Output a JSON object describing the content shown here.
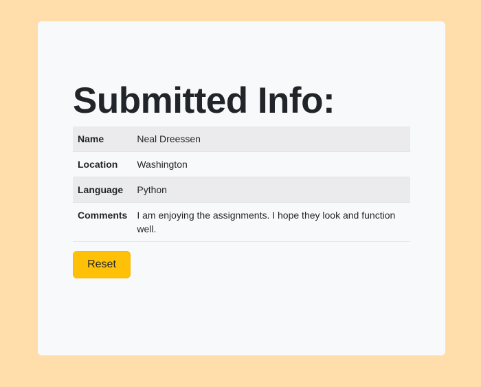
{
  "page": {
    "title": "Submitted Info:"
  },
  "info_table": {
    "rows": [
      {
        "label": "Name",
        "value": "Neal Dreessen"
      },
      {
        "label": "Location",
        "value": "Washington"
      },
      {
        "label": "Language",
        "value": "Python"
      },
      {
        "label": "Comments",
        "value": "I am enjoying the assignments. I hope they look and function well."
      }
    ]
  },
  "actions": {
    "reset_label": "Reset"
  },
  "colors": {
    "page_background": "#ffdeab",
    "card_background": "#f8f9fa",
    "button_accent": "#ffc107",
    "text": "#212529"
  }
}
